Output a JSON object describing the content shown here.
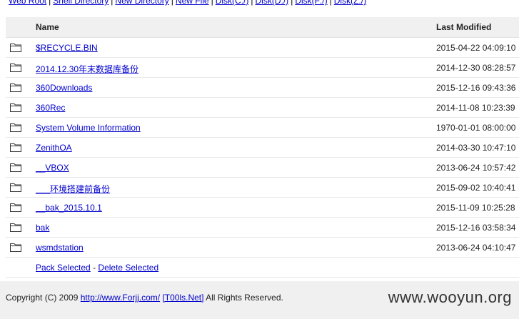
{
  "nav": {
    "links": [
      "Web Root",
      "Shell Directory",
      "New Directory",
      "New File",
      "Disk(C:/)",
      "Disk(D:/)",
      "Disk(F:/)",
      "Disk(Z:/)"
    ],
    "separator": "|"
  },
  "table": {
    "col_name": "Name",
    "col_modified": "Last Modified",
    "rows": [
      {
        "name": "$RECYCLE.BIN",
        "modified": "2015-04-22 04:09:10"
      },
      {
        "name": "2014.12.30年末数据库备份",
        "modified": "2014-12-30 08:28:57"
      },
      {
        "name": "360Downloads",
        "modified": "2015-12-16 09:43:36"
      },
      {
        "name": "360Rec",
        "modified": "2014-11-08 10:23:39"
      },
      {
        "name": "System Volume Information",
        "modified": "1970-01-01 08:00:00"
      },
      {
        "name": "ZenithOA",
        "modified": "2014-03-30 10:47:10"
      },
      {
        "name": "__VBOX",
        "modified": "2013-06-24 10:57:42"
      },
      {
        "name": "___环境搭建前备份",
        "modified": "2015-09-02 10:40:41"
      },
      {
        "name": "__bak_2015.10.1",
        "modified": "2015-11-09 10:25:28"
      },
      {
        "name": "bak",
        "modified": "2015-12-16 03:58:34"
      },
      {
        "name": "wsmdstation",
        "modified": "2013-06-24 04:10:47"
      }
    ]
  },
  "actions": {
    "pack": "Pack Selected",
    "separator": "-",
    "delete": "Delete Selected"
  },
  "footer": {
    "prefix": "Copyright (C) 2009",
    "link1": "http://www.Forjj.com/",
    "link2": "[T00ls.Net]",
    "suffix": "All Rights Reserved.",
    "watermark": "www.wooyun.org"
  },
  "icons": {
    "folder": "folder-icon"
  }
}
